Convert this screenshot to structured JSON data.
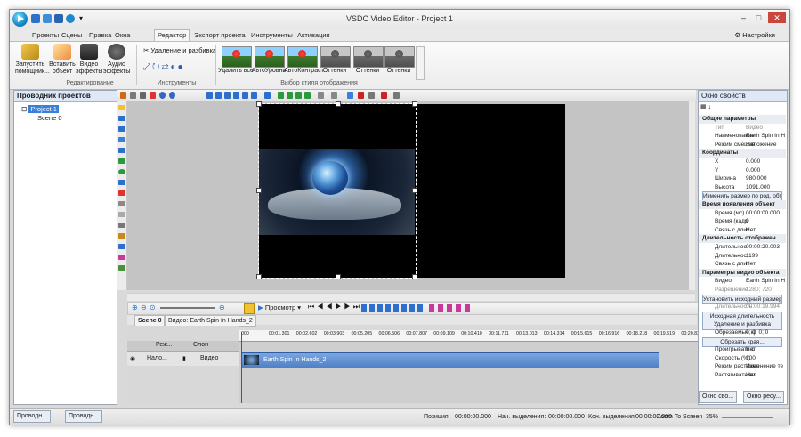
{
  "window": {
    "title": "VSDC Video Editor - Project 1"
  },
  "menu": {
    "tabs": [
      "Проекты",
      "Сцены",
      "Правка",
      "Окна",
      "Редактор",
      "Экспорт проекта",
      "Инструменты",
      "Активация"
    ],
    "active": "Редактор",
    "settings": "Настройки"
  },
  "ribbon": {
    "run_wizard": "Запустить помощник...",
    "insert_object": "Вставить объект",
    "video_effects": "Видео эффекты",
    "audio_effects": "Аудио эффекты",
    "editing_group": "Редактирование",
    "cut_split": "Удаление и разбивка",
    "tools_group": "Инструменты",
    "styles": [
      "Удалить все",
      "АвтоУровни",
      "АвтоКонтраст",
      "Оттенки",
      "Оттенки",
      "Оттенки"
    ],
    "styles_group": "Выбор стиля отображения"
  },
  "project_explorer": {
    "title": "Проводник проектов",
    "project": "Project 1",
    "scene": "Scene 0"
  },
  "timeline": {
    "preview": "Просмотр",
    "tabs": [
      "Scene 0",
      "Видео: Earth Spin In Hands_2"
    ],
    "ruler": [
      "000",
      "00:01.301",
      "00:02.602",
      "00:03.903",
      "00:05.205",
      "00:06.506",
      "00:07.807",
      "00:09.109",
      "00:10.410",
      "00:11.711",
      "00:13.013",
      "00:14.314",
      "00:15.615",
      "00:16.916",
      "00:18.218",
      "00:19.519",
      "00:20.820"
    ],
    "header_mode": "Реж...",
    "header_layers": "Слои",
    "track_blend": "Нало...",
    "track_name": "Видео",
    "clip_name": "Earth Spin In Hands_2"
  },
  "properties": {
    "title": "Окно свойств",
    "rows": [
      {
        "type": "cat",
        "k": "Общие параметры"
      },
      {
        "k": "Тип",
        "v": "Видео",
        "muted": true
      },
      {
        "k": "Наименование",
        "v": "Earth Spin In H"
      },
      {
        "k": "Режим смешив",
        "v": "Наложение"
      },
      {
        "type": "cat",
        "k": "Координаты"
      },
      {
        "k": "X",
        "v": "0.000"
      },
      {
        "k": "Y",
        "v": "0.000"
      },
      {
        "k": "Ширина",
        "v": "980.000"
      },
      {
        "k": "Высота",
        "v": "1091.000"
      },
      {
        "type": "btn",
        "k": "Изменить размер по род. объекту"
      },
      {
        "type": "cat",
        "k": "Время появления объект"
      },
      {
        "k": "Время (мс)",
        "v": "00:00:00.000"
      },
      {
        "k": "Время (кадр",
        "v": "0"
      },
      {
        "k": "Связь с длит",
        "v": "Нет"
      },
      {
        "type": "cat",
        "k": "Длительность отображен"
      },
      {
        "k": "Длительнос",
        "v": "00:00:20.003"
      },
      {
        "k": "Длительнос",
        "v": "1199"
      },
      {
        "k": "Связь с длит",
        "v": "Нет"
      },
      {
        "type": "cat",
        "k": "Параметры видео объекта"
      },
      {
        "k": "Видео",
        "v": "Earth Spin In H"
      },
      {
        "k": "Разрешение",
        "v": "1280; 720",
        "muted": true
      },
      {
        "type": "btn",
        "k": "Установить исходный размер"
      },
      {
        "k": "Длительность",
        "v": "00:00:19.994",
        "muted": true
      },
      {
        "type": "btn",
        "k": "Исходная длительность"
      },
      {
        "type": "btn",
        "k": "Удаление и разбивка"
      },
      {
        "k": "Обрезаемые кр",
        "v": "0; 0; 0; 0"
      },
      {
        "type": "btn",
        "k": "Обрезать края..."
      },
      {
        "k": "Проигрывать с",
        "v": "Нет"
      },
      {
        "k": "Скорость (%)",
        "v": "100"
      },
      {
        "k": "Режим растяжен",
        "v": "Изменение те"
      },
      {
        "k": "Растягивать ви",
        "v": "Нет"
      }
    ]
  },
  "bottom_tabs": {
    "left": [
      "Проводн...",
      "Проводн..."
    ],
    "right": [
      "Окно сво...",
      "Окно ресу..."
    ]
  },
  "status": {
    "position_label": "Позиция:",
    "position": "00:00:00.000",
    "sel_start_label": "Нач. выделения:",
    "sel_start": "00:00:00.000",
    "sel_end_label": "Кон. выделения:",
    "sel_end": "00:00:00.000",
    "zoom_label": "Zoom To Screen",
    "zoom": "35%"
  }
}
